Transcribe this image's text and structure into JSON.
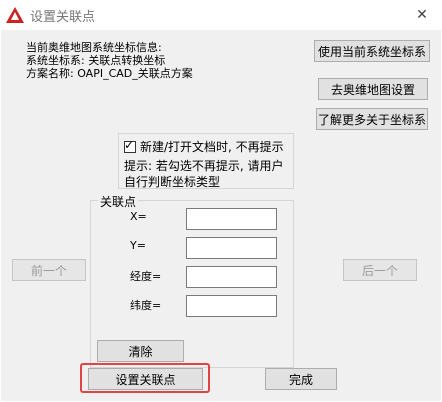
{
  "window": {
    "title": "设置关联点",
    "close_glyph": "✕"
  },
  "info": {
    "line1": "当前奥维地图系统坐标信息:",
    "line2": "系统坐标系: 关联点转换坐标",
    "line3": "方案名称: OAPI_CAD_关联点方案"
  },
  "buttons": {
    "use_current": "使用当前系统坐标系",
    "goto_ovital": "去奥维地图设置",
    "learn_more": "了解更多关于坐标系",
    "prev": "前一个",
    "next": "后一个",
    "clear": "清除",
    "set_points": "设置关联点",
    "done": "完成"
  },
  "checkbox": {
    "label": "新建/打开文档时, 不再提示",
    "checked": true,
    "check_glyph": "✓"
  },
  "hint": {
    "line1": "提示: 若勾选不再提示, 请用户",
    "line2": "自行判断坐标类型"
  },
  "group": {
    "label": "关联点",
    "fields": {
      "x": {
        "label": "X=",
        "value": ""
      },
      "y": {
        "label": "Y=",
        "value": ""
      },
      "lon": {
        "label": "经度=",
        "value": ""
      },
      "lat": {
        "label": "纬度=",
        "value": ""
      }
    }
  }
}
